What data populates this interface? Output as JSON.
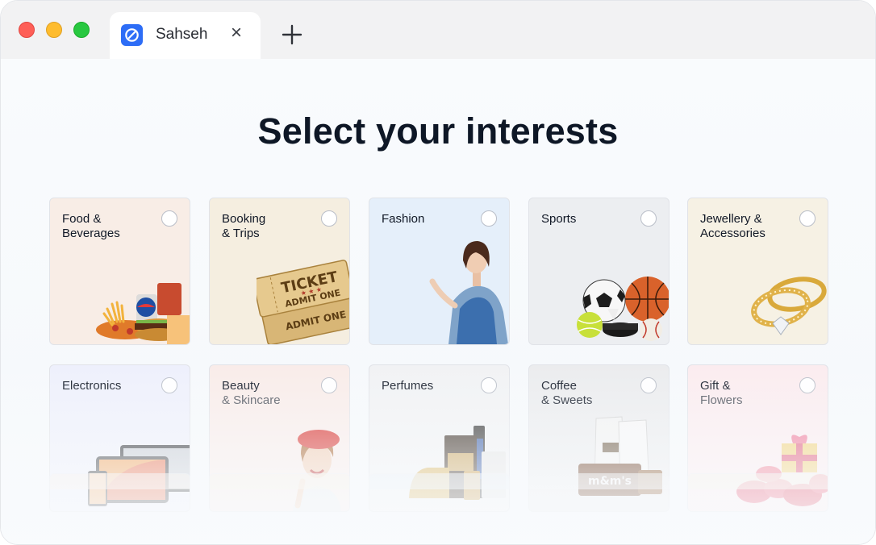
{
  "browser": {
    "tab_title": "Sahseh",
    "tab_close_glyph": "×",
    "new_tab_icon": "plus-icon"
  },
  "page": {
    "heading": "Select your interests"
  },
  "colors": {
    "accent": "#2d6df6",
    "heading": "#0e1726",
    "close": "#fe5f57",
    "minimize": "#febc2e",
    "maximize": "#28c840"
  },
  "interests": [
    {
      "id": "food",
      "line1": "Food &",
      "line2": "Beverages",
      "bg": "#f8ede6",
      "selected": false,
      "icon": "food-beverages-image"
    },
    {
      "id": "booking",
      "line1": "Booking",
      "line2": "& Trips",
      "bg": "#f5eee0",
      "selected": false,
      "icon": "ticket-image"
    },
    {
      "id": "fashion",
      "line1": "Fashion",
      "line2": "",
      "bg": "#e5effa",
      "selected": false,
      "icon": "fashion-model-image"
    },
    {
      "id": "sports",
      "line1": "Sports",
      "line2": "",
      "bg": "#eceef1",
      "selected": false,
      "icon": "sports-balls-image"
    },
    {
      "id": "jewellery",
      "line1": "Jewellery &",
      "line2": "Accessories",
      "bg": "#f6f1e4",
      "selected": false,
      "icon": "rings-image"
    },
    {
      "id": "electronics",
      "line1": "Electronics",
      "line2": "",
      "bg": "#eef0fc",
      "selected": false,
      "icon": "devices-image"
    },
    {
      "id": "beauty",
      "line1": "Beauty",
      "line2": "& Skincare",
      "bg": "#f9ece9",
      "selected": false,
      "icon": "beauty-woman-image"
    },
    {
      "id": "perfumes",
      "line1": "Perfumes",
      "line2": "",
      "bg": "#f1f2f4",
      "selected": false,
      "icon": "perfume-bottles-image"
    },
    {
      "id": "coffee",
      "line1": "Coffee",
      "line2": "& Sweets",
      "bg": "#ebecee",
      "selected": false,
      "icon": "coffee-sweets-image"
    },
    {
      "id": "gift",
      "line1": "Gift &",
      "line2": "Flowers",
      "bg": "#fbecef",
      "selected": false,
      "icon": "gift-flowers-image"
    }
  ]
}
